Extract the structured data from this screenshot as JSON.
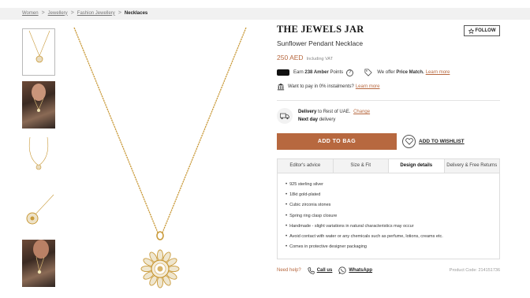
{
  "breadcrumb": {
    "items": [
      "Women",
      "Jewellery",
      "Fashion Jewellery"
    ],
    "current": "Necklaces",
    "separator": ">"
  },
  "product": {
    "brand": "THE JEWELS JAR",
    "follow_label": "FOLLOW",
    "name": "Sunflower Pendant Necklace",
    "price": "250 AED",
    "vat_note": "Including VAT"
  },
  "promos": {
    "amber_prefix": "Earn",
    "amber_points": "238 Amber",
    "amber_suffix": "Points",
    "help_glyph": "?",
    "price_match_prefix": "We offer",
    "price_match": "Price Match.",
    "learn_more_1": "Learn more",
    "installments": "Want to pay in 0% instalments?",
    "learn_more_2": "Learn more"
  },
  "delivery": {
    "label": "Delivery",
    "to": "to Rest of UAE.",
    "change": "Change",
    "speed_bold": "Next day",
    "speed": "delivery"
  },
  "actions": {
    "add_to_bag": "ADD TO BAG",
    "add_to_wishlist": "ADD TO WISHLIST"
  },
  "tabs": [
    {
      "label": "Editor's advice",
      "active": false
    },
    {
      "label": "Size & Fit",
      "active": false
    },
    {
      "label": "Design details",
      "active": true
    },
    {
      "label": "Delivery & Free Returns",
      "active": false
    }
  ],
  "design_details": [
    "925 sterling silver",
    "18kt gold-plated",
    "Cubic zirconia stones",
    "Spring ring clasp closure",
    "Handmade - slight variations in natural characteristics may occur",
    "Avoid contact with water or any chemicals such as perfume, lotions, creams etc.",
    "Comes in protective designer packaging"
  ],
  "footer": {
    "need_help": "Need help?",
    "call_us": "Call us",
    "whatsapp": "WhatsApp",
    "product_code": "Product Code: 214151736"
  },
  "colors": {
    "accent": "#b7683f",
    "gold": "#c99a3a",
    "border": "#dddddd"
  },
  "icons": [
    "star-icon",
    "amber-badge-icon",
    "help-icon",
    "tag-icon",
    "bank-icon",
    "truck-icon",
    "heart-icon",
    "phone-icon",
    "whatsapp-icon"
  ]
}
